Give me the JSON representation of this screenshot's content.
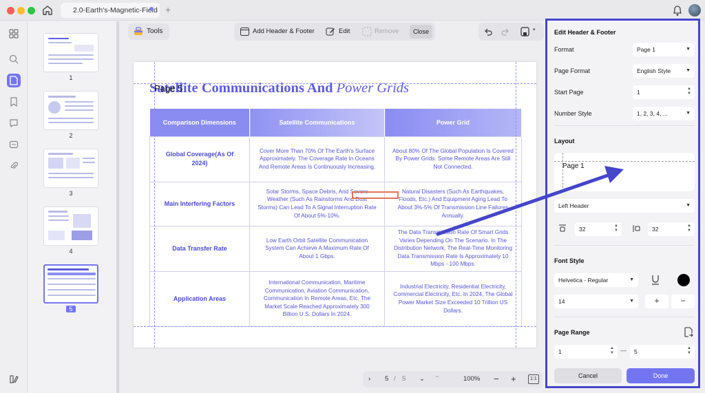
{
  "window": {
    "tab_title": "2.0-Earth's-Magnetic-Field",
    "new_tab": "+",
    "colors": {
      "accent": "#7375f0",
      "panel_border": "#4546c9",
      "title": "#5e5ce0"
    }
  },
  "sidebar": {
    "icons": [
      "thumbnails-icon",
      "search-icon",
      "pages-icon",
      "bookmark-icon",
      "comment-icon",
      "form-icon",
      "attachment-icon",
      "layers-icon"
    ]
  },
  "thumbnails": [
    {
      "number": "1"
    },
    {
      "number": "2"
    },
    {
      "number": "3"
    },
    {
      "number": "4"
    },
    {
      "number": "5",
      "selected": true
    }
  ],
  "toolbar": {
    "tools": "Tools",
    "add_header_footer": "Add Header & Footer",
    "edit": "Edit",
    "remove": "Remove",
    "close": "Close"
  },
  "document": {
    "header_overlay": "Page 5",
    "title_main": "Satellite Communications And",
    "title_italic": "Power Grids",
    "table": {
      "headers": [
        "Comparison Dimensions",
        "Satellite Communications",
        "Power Grid"
      ],
      "rows": [
        [
          "Global Coverage(As Of 2024)",
          "Cover More Than 70% Of The Earth's Surface Approximately. The Coverage Rate In Oceans And Remote Areas Is Continuously Increasing.",
          "About 80% Of The Global Population Is Covered By Power Grids. Some Remote Areas Are Still Not Connected."
        ],
        [
          "Main Interfering Factors",
          "Solar Storms, Space Debris, And Severe Weather (Such As Rainstorms And Dust Storms) Can Lead To A Signal Interruption Rate Of About 5%-10%.",
          "Natural Disasters (Such As Earthquakes, Floods, Etc.) And Equipment Aging Lead To About 3%-5% Of Transmission Line Failures Annually."
        ],
        [
          "Data Transfer Rate",
          "Low Earth Orbit Satellite Communication System Can Achieve A Maximum Rate Of About 1 Gbps.",
          "The Data Transmission Rate Of Smart Grids Varies Depending On The Scenario. In The Distribution Network, The Real-Time Monitoring Data Transmission Rate Is Approximately 10 Mbps - 100 Mbps."
        ],
        [
          "Application Areas",
          "International Communication, Maritime Communication, Aviation Communication, Communication In Remote Areas, Etc. The Market Scale Reached Approximately 300 Billion U.S. Dollars In 2024.",
          "Industrial Electricity, Residential Electricity, Commercial Electricity, Etc. In 2024, The Global Power Market Size Exceeded 10 Trillion US Dollars."
        ]
      ]
    }
  },
  "zoombar": {
    "current_page": "5",
    "separator": "/",
    "total_pages": "5",
    "zoom": "100%"
  },
  "panel": {
    "title": "Edit Header & Footer",
    "format_label": "Format",
    "format_value": "Page 1",
    "page_format_label": "Page Format",
    "page_format_value": "English Style",
    "start_page_label": "Start Page",
    "start_page_value": "1",
    "number_style_label": "Number Style",
    "number_style_value": "1, 2, 3, 4, ...",
    "layout_title": "Layout",
    "layout_preview_text": "Page 1",
    "position_value": "Left Header",
    "margin_top_value": "32",
    "margin_side_value": "32",
    "font_style_title": "Font Style",
    "font_value": "Helvetica - Regular",
    "font_size_value": "14",
    "font_color": "#000000",
    "page_range_title": "Page Range",
    "range_from": "1",
    "range_dash": "—",
    "range_to": "5",
    "cancel": "Cancel",
    "done": "Done"
  }
}
